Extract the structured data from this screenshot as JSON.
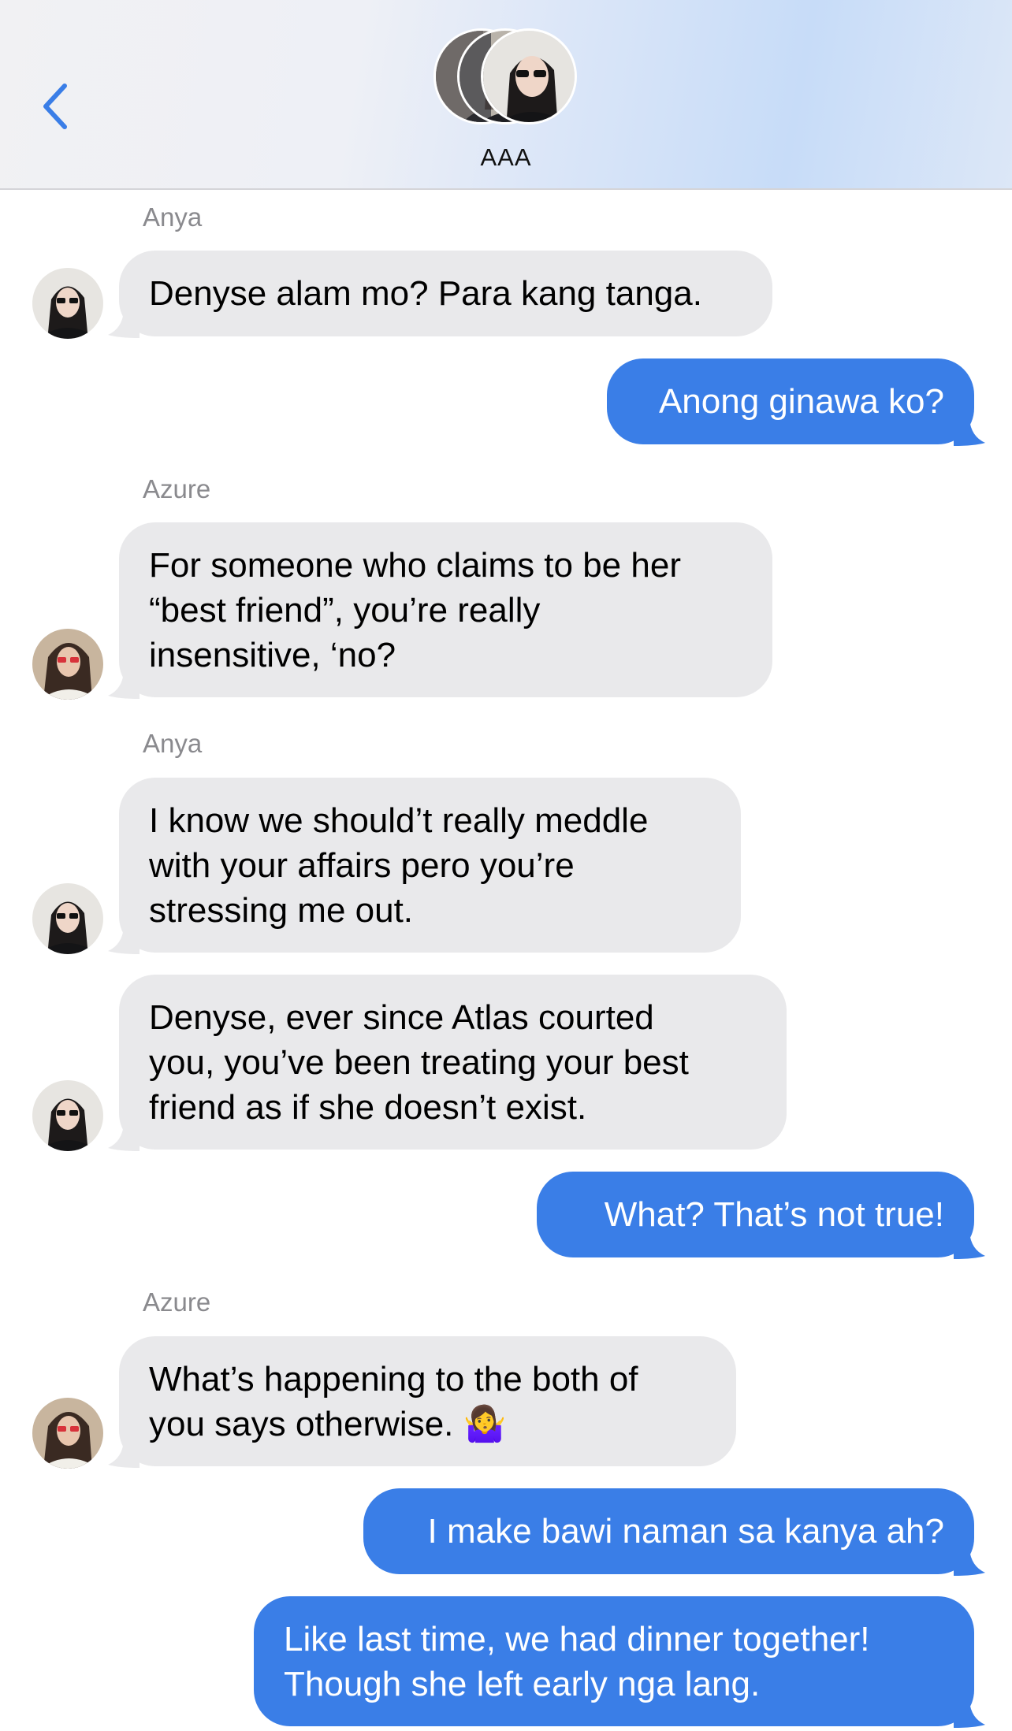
{
  "header": {
    "title": "AAA",
    "back_icon": "chevron-left-icon",
    "accent": "#3a7ee7"
  },
  "messages": [
    {
      "sender": "Anya",
      "direction": "incoming",
      "lines": [
        "Denyse alam mo? Para kang tanga."
      ]
    },
    {
      "sender": "",
      "direction": "outgoing",
      "lines": [
        "Anong ginawa ko?"
      ]
    },
    {
      "sender": "Azure",
      "direction": "incoming",
      "lines": [
        "For someone who claims to be her",
        "“best friend”, you’re really",
        "insensitive, ‘no?"
      ]
    },
    {
      "sender": "Anya",
      "direction": "incoming",
      "lines": [
        "I know we should’t really meddle",
        "with your affairs pero you’re",
        "stressing me out."
      ]
    },
    {
      "sender": "",
      "direction": "incoming",
      "lines": [
        "Denyse, ever since Atlas courted",
        "you, you’ve been treating your best",
        "friend as if she doesn’t exist."
      ]
    },
    {
      "sender": "",
      "direction": "outgoing",
      "lines": [
        "What? That’s not true!"
      ]
    },
    {
      "sender": "Azure",
      "direction": "incoming",
      "lines": [
        "What’s happening to the both of",
        "you says otherwise. 🤷‍♀️"
      ]
    },
    {
      "sender": "",
      "direction": "outgoing",
      "lines": [
        "I make bawi naman sa kanya ah?"
      ]
    },
    {
      "sender": "",
      "direction": "outgoing",
      "lines": [
        "Like last time, we had dinner together!",
        "Though she left early nga lang."
      ]
    }
  ]
}
